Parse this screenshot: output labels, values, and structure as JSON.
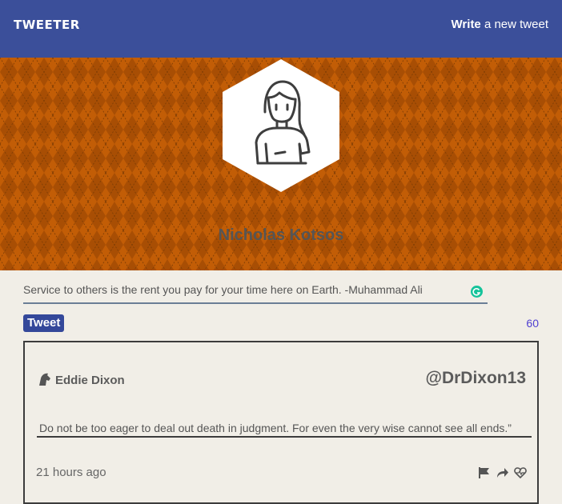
{
  "nav": {
    "brand": "TWEETER",
    "compose_bold": "Write",
    "compose_rest": " a new tweet"
  },
  "profile": {
    "name": "Nicholas Kotsos",
    "avatar_icon": "user-avatar-icon"
  },
  "compose": {
    "value": "Service to others is the rent you pay for your time here on Earth. -Muhammad Ali",
    "button": "Tweet",
    "counter": "60"
  },
  "tweets": [
    {
      "author": "Eddie Dixon",
      "handle": "@DrDixon13",
      "body": "Do not be too eager to deal out death in judgment. For even the very wise cannot see all ends.”",
      "time": "21 hours ago",
      "actions": [
        "flag-icon",
        "retweet-icon",
        "heart-icon"
      ]
    }
  ],
  "colors": {
    "nav": "#3b4f9a",
    "header": "#c25d06",
    "button": "#34489a",
    "counter": "#4f3fd1",
    "background": "#f1eee7"
  }
}
